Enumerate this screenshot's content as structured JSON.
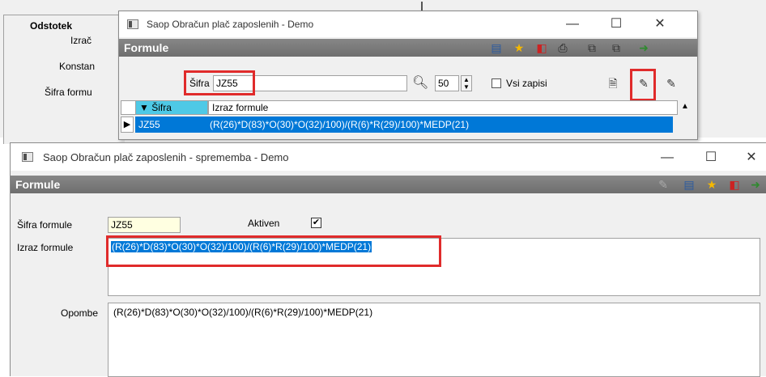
{
  "background": {
    "labels": [
      "Odstotek",
      "Izrač",
      "Konstan",
      "Šifra formu"
    ]
  },
  "dialog1": {
    "title": "Saop Obračun plač zaposlenih - Demo",
    "header": "Formule",
    "search_label": "Šifra",
    "search_value": "JZ55",
    "page_size": "50",
    "all_records_label": "Vsi zapisi",
    "columns": [
      "Šifra",
      "Izraz formule"
    ],
    "row": {
      "sifra": "JZ55",
      "izraz": "(R(26)*D(83)*O(30)*O(32)/100)/(R(6)*R(29)/100)*MEDP(21)"
    }
  },
  "dialog2": {
    "title": "Saop Obračun plač zaposlenih - sprememba - Demo",
    "header": "Formule",
    "sifra_label": "Šifra formule",
    "sifra_value": "JZ55",
    "aktiven_label": "Aktiven",
    "aktiven_checked": true,
    "izraz_label": "Izraz formule",
    "izraz_value": "(R(26)*D(83)*O(30)*O(32)/100)/(R(6)*R(29)/100)*MEDP(21)",
    "opombe_label": "Opombe",
    "opombe_value": "(R(26)*D(83)*O(30)*O(32)/100)/(R(6)*R(29)/100)*MEDP(21)"
  },
  "colors": {
    "highlight": "#e02b2b",
    "selection": "#0078d7",
    "header_bar": "#787878",
    "sifra_field": "#ffffe1"
  }
}
